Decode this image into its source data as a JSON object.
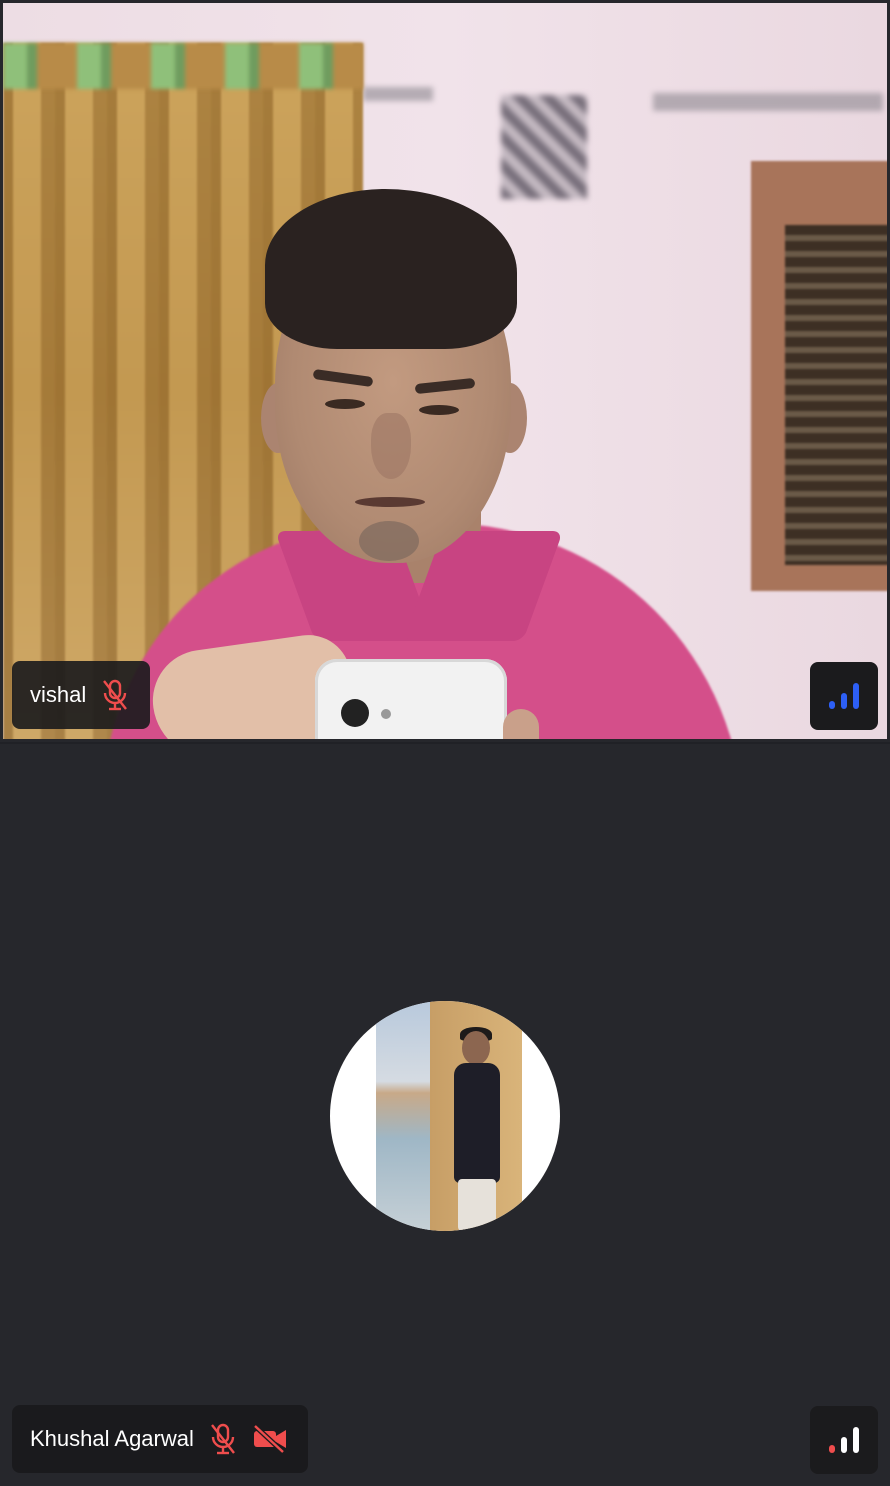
{
  "participants": [
    {
      "name": "vishal",
      "mic_state": "muted",
      "mic_icon": "mic-off-icon",
      "video_state": "on",
      "signal_icon": "network-signal-icon",
      "signal_color": "#2d5ff5"
    },
    {
      "name": "Khushal Agarwal",
      "mic_state": "muted",
      "mic_icon": "mic-off-icon",
      "video_state": "off",
      "video_icon": "video-off-icon",
      "avatar_icon": "profile-photo",
      "signal_icon": "network-signal-icon",
      "signal_color": "#ef4d4d"
    }
  ],
  "colors": {
    "muted_red": "#ef4d4d",
    "tile_background": "#26272c",
    "chip_background": "#1b1b1d",
    "signal_good": "#2d5ff5",
    "signal_inactive": "#ffffff"
  }
}
